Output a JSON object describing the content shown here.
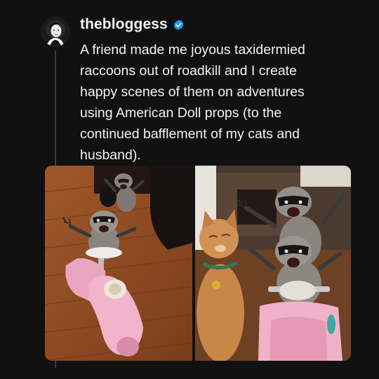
{
  "post": {
    "username": "thebloggess",
    "verified": true,
    "text": "A friend made me joyous taxidermied\nraccoons out of roadkill and I create\nhappy scenes of them on adventures\nusing American Doll props (to the\ncontinued bafflement of my cats and\nhusband).",
    "avatar_icon": "profile-photo-avatar",
    "verified_icon": "verified-check-icon"
  },
  "media": {
    "count": 2,
    "images": [
      {
        "icon": "raccoons-on-pink-scooter-photo"
      },
      {
        "icon": "cat-watching-raccoons-on-scooter-photo"
      }
    ]
  },
  "colors": {
    "background": "#111111",
    "text": "#f3f3f3",
    "verified_badge": "#1d9bf0",
    "thread_line": "#3a3a3a"
  }
}
